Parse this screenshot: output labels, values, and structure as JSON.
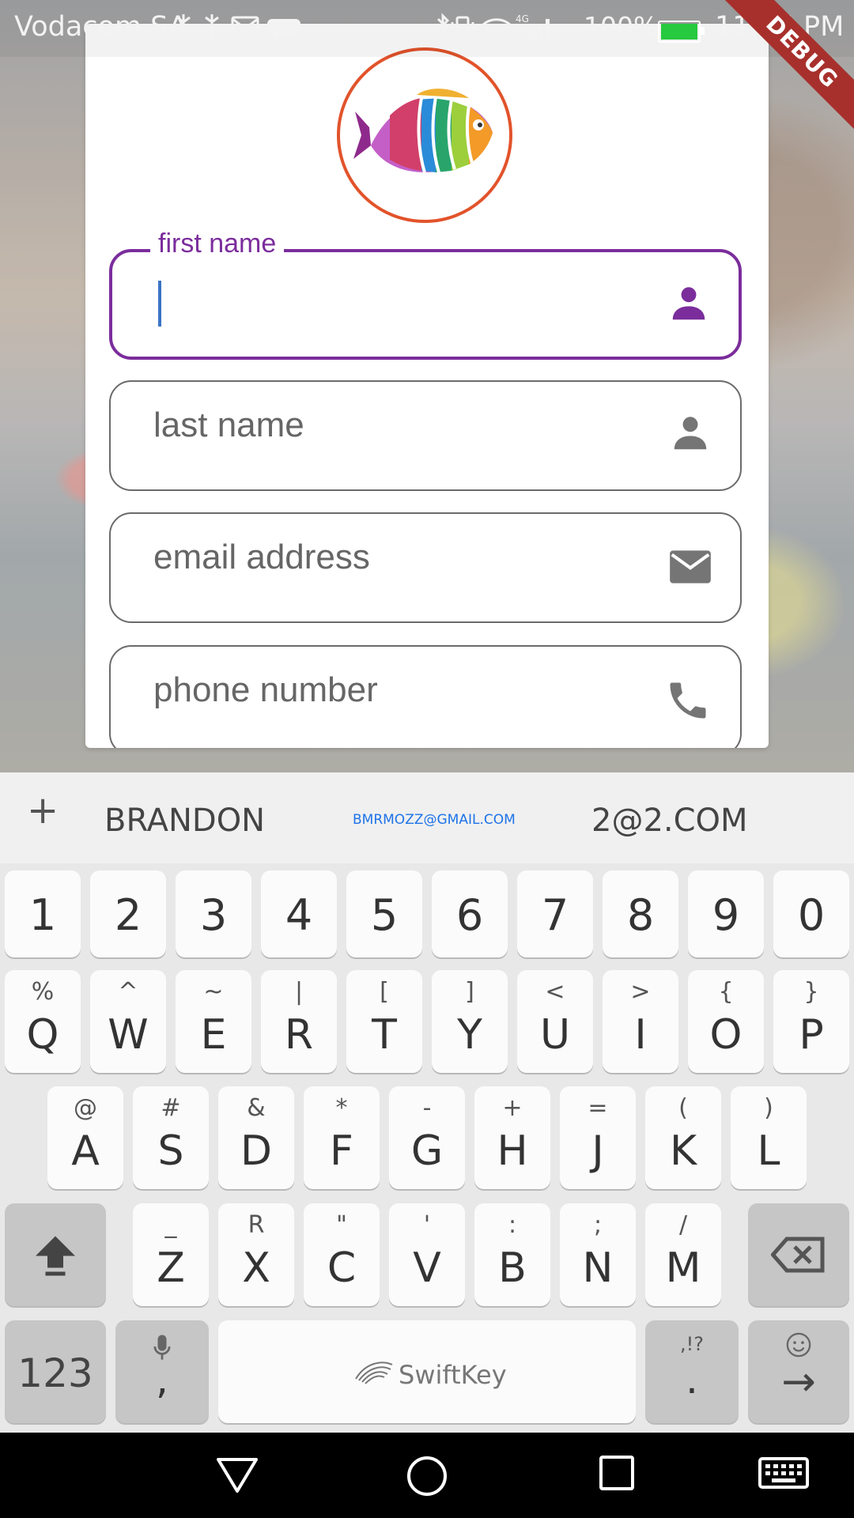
{
  "status_bar": {
    "carrier": "Vodacom SA",
    "battery": "100%",
    "time": "11:55 PM",
    "network_badge": "4G"
  },
  "debug_banner": "DEBUG",
  "form": {
    "first_name": {
      "label": "first name",
      "icon": "person-icon"
    },
    "last_name": {
      "label": "last name",
      "icon": "person-icon"
    },
    "email": {
      "label": "email address",
      "icon": "mail-icon"
    },
    "phone": {
      "label": "phone number",
      "icon": "phone-icon"
    }
  },
  "keyboard": {
    "suggestions": [
      "BRANDON",
      "BMRMOZZ@GMAIL.COM",
      "2@2.COM"
    ],
    "number_row": [
      "1",
      "2",
      "3",
      "4",
      "5",
      "6",
      "7",
      "8",
      "9",
      "0"
    ],
    "row1": [
      {
        "main": "Q",
        "sub": "%"
      },
      {
        "main": "W",
        "sub": "^"
      },
      {
        "main": "E",
        "sub": "~"
      },
      {
        "main": "R",
        "sub": "|"
      },
      {
        "main": "T",
        "sub": "["
      },
      {
        "main": "Y",
        "sub": "]"
      },
      {
        "main": "U",
        "sub": "<"
      },
      {
        "main": "I",
        "sub": ">"
      },
      {
        "main": "O",
        "sub": "{"
      },
      {
        "main": "P",
        "sub": "}"
      }
    ],
    "row2": [
      {
        "main": "A",
        "sub": "@"
      },
      {
        "main": "S",
        "sub": "#"
      },
      {
        "main": "D",
        "sub": "&"
      },
      {
        "main": "F",
        "sub": "*"
      },
      {
        "main": "G",
        "sub": "-"
      },
      {
        "main": "H",
        "sub": "+"
      },
      {
        "main": "J",
        "sub": "="
      },
      {
        "main": "K",
        "sub": "("
      },
      {
        "main": "L",
        "sub": ")"
      }
    ],
    "row3": [
      {
        "main": "Z",
        "sub": "_"
      },
      {
        "main": "X",
        "sub": "R"
      },
      {
        "main": "C",
        "sub": "\""
      },
      {
        "main": "V",
        "sub": "'"
      },
      {
        "main": "B",
        "sub": ":"
      },
      {
        "main": "N",
        "sub": ";"
      },
      {
        "main": "M",
        "sub": "/"
      }
    ],
    "key_123": "123",
    "comma_key": ",",
    "space_label": "SwiftKey",
    "period_key": ".",
    "period_sub": ",!?",
    "enter_symbol": "→"
  }
}
